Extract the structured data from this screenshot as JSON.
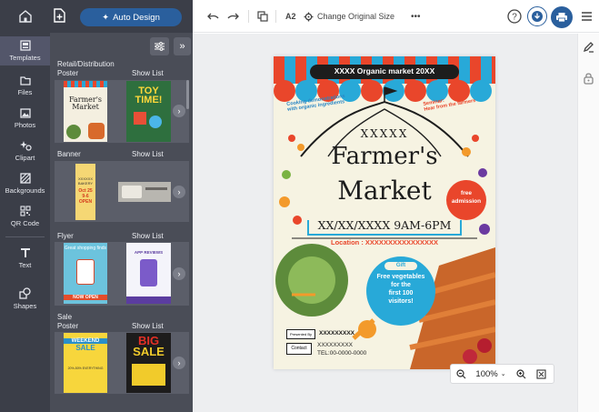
{
  "sidebar": {
    "items": [
      {
        "label": "Templates",
        "icon": "templates-icon"
      },
      {
        "label": "Files",
        "icon": "folder-icon"
      },
      {
        "label": "Photos",
        "icon": "photo-icon"
      },
      {
        "label": "Clipart",
        "icon": "clipart-icon"
      },
      {
        "label": "Backgrounds",
        "icon": "backgrounds-icon"
      },
      {
        "label": "QR Code",
        "icon": "qr-code-icon"
      },
      {
        "label": "Text",
        "icon": "text-icon"
      },
      {
        "label": "Shapes",
        "icon": "shapes-icon"
      }
    ]
  },
  "topbar": {
    "auto_design": "Auto Design"
  },
  "panel": {
    "categories": [
      {
        "name": "Retail/Distribution\nPoster",
        "show": "Show List"
      },
      {
        "name": "Banner",
        "show": "Show List"
      },
      {
        "name": "Flyer",
        "show": "Show List"
      },
      {
        "name": "Sale\nPoster",
        "show": "Show List"
      }
    ],
    "thumbs": {
      "t1": "Farmer's Market",
      "t2": "TOY TIME!",
      "t3a": "XXXXXX BAKERY",
      "t3b": "Oct 25 9-6 OPEN",
      "t5a": "Great shopping finds",
      "t5b": "NOW OPEN",
      "t6": "APP REVIEWS",
      "t7a": "WEEKEND",
      "t7b": "SALE",
      "t7c": "20%-50% EVERYTHING",
      "t8a": "BIG",
      "t8b": "SALE"
    }
  },
  "toolbar": {
    "size_label": "A2",
    "change_size": "Change Original Size",
    "more": "•••"
  },
  "poster": {
    "banner": "XXXX Organic market 20XX",
    "left_note": "Cooking demonstrations\nwith organic ingredients",
    "right_note": "Seminar:\nHear from the farmers",
    "xxxxx": "XXXXX",
    "title1": "Farmer's",
    "title2": "Market",
    "free": "free\nadmission",
    "date": "XX/XX/XXXX 9AM-6PM",
    "location": "Location : XXXXXXXXXXXXXXXX",
    "gift_tag": "Gift",
    "gift": "Free vegetables\nfor the\nfirst 100\nvisitors!",
    "presented_label": "Presented By",
    "presented_value": "XXXXXXXXX",
    "contact_label": "Contact",
    "contact_name": "XXXXXXXXX",
    "contact_tel": "TEL:00-0000-0000"
  },
  "zoom": {
    "level": "100%"
  },
  "colors": {
    "accent": "#2a5f9d",
    "poster_red": "#e9462b",
    "poster_blue": "#28a9d8"
  }
}
